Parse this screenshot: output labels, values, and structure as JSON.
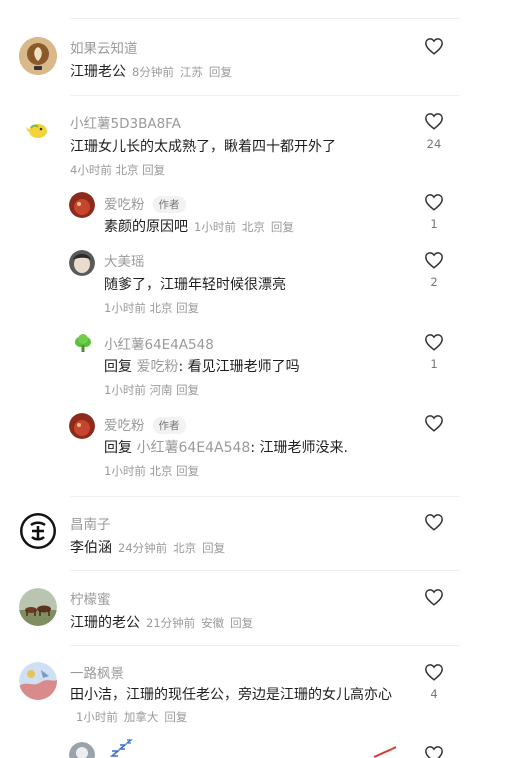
{
  "comments": [
    {
      "name": "如果云知道",
      "text": "江珊老公",
      "time": "8分钟前",
      "location": "江苏",
      "reply": "回复",
      "likes": ""
    },
    {
      "name": "小红薯5D3BA8FA",
      "text": "江珊女儿长的太成熟了，瞅着四十都开外了",
      "time": "4小时前",
      "location": "北京",
      "reply": "回复",
      "likes": "24",
      "replies": [
        {
          "name": "爱吃粉",
          "tag": "作者",
          "text": "素颜的原因吧",
          "time": "1小时前",
          "location": "北京",
          "reply": "回复",
          "likes": "1"
        },
        {
          "name": "大美瑶",
          "text": "随爹了，江珊年轻时候很漂亮",
          "time": "1小时前",
          "location": "北京",
          "reply": "回复",
          "likes": "2"
        },
        {
          "name": "小红薯64E4A548",
          "prefix": "回复",
          "reply_to": "爱吃粉",
          "text": ": 看见江珊老师了吗",
          "time": "1小时前",
          "location": "河南",
          "reply": "回复",
          "likes": "1"
        },
        {
          "name": "爱吃粉",
          "tag": "作者",
          "prefix": "回复",
          "reply_to": "小红薯64E4A548",
          "text": ": 江珊老师没来.",
          "time": "1小时前",
          "location": "北京",
          "reply": "回复",
          "likes": ""
        }
      ]
    },
    {
      "name": "昌南子",
      "text": "李伯涵",
      "time": "24分钟前",
      "location": "北京",
      "reply": "回复",
      "likes": ""
    },
    {
      "name": "柠檬蜜",
      "text": "江珊的老公",
      "time": "21分钟前",
      "location": "安徽",
      "reply": "回复",
      "likes": ""
    },
    {
      "name": "一路枫景",
      "text": "田小洁，江珊的现任老公，旁边是江珊的女儿高亦心",
      "time": "1小时前",
      "location": "加拿大",
      "reply": "回复",
      "likes": "4"
    }
  ],
  "colors": {
    "name_gray": "#9a9a9a",
    "text_dark": "#1e1e1e",
    "divider": "#f0f0f0"
  },
  "icons": {
    "like": "heart-outline-icon",
    "sleep": "zzz-icon"
  }
}
